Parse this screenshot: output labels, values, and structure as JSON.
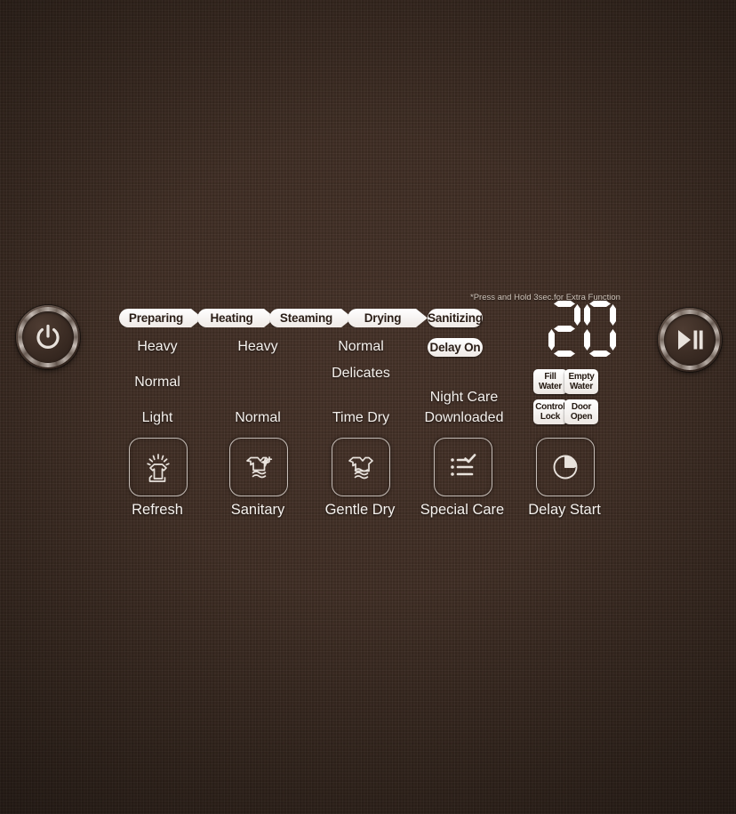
{
  "panel": {
    "background_color": "#3b2b22",
    "text_color": "#f4f0ec"
  },
  "power_button": {
    "name": "Power",
    "icon": "power-icon"
  },
  "start_button": {
    "name": "Start/Pause",
    "icon": "play-pause-icon"
  },
  "note": "*Press and Hold 3sec.for Extra Function",
  "progress_pills": [
    {
      "label": "Preparing",
      "shape": "arrow"
    },
    {
      "label": "Heating",
      "shape": "arrow"
    },
    {
      "label": "Steaming",
      "shape": "arrow"
    },
    {
      "label": "Drying",
      "shape": "arrow"
    },
    {
      "label": "Sanitizing",
      "shape": "round"
    }
  ],
  "option_labels": [
    {
      "label": "Heavy"
    },
    {
      "label": "Heavy"
    },
    {
      "label": "Normal"
    },
    {
      "label": "Delay On"
    },
    {
      "label": "Normal"
    },
    {
      "label": "Delicates"
    },
    {
      "label": "Night Care"
    },
    {
      "label": "Light"
    },
    {
      "label": "Normal"
    },
    {
      "label": "Time Dry"
    },
    {
      "label": "Downloaded"
    }
  ],
  "display": {
    "value": "20",
    "digits": [
      "2",
      "0"
    ],
    "segments": {
      "0": [
        "A",
        "B",
        "C",
        "D",
        "E",
        "F"
      ],
      "2": [
        "A",
        "B",
        "G",
        "E",
        "D"
      ]
    }
  },
  "status_chips": [
    {
      "line1": "Fill",
      "line2": "Water",
      "name": "fill-water"
    },
    {
      "line1": "Empty",
      "line2": "Water",
      "name": "empty-water"
    },
    {
      "line1": "Control",
      "line2": "Lock",
      "name": "control-lock"
    },
    {
      "line1": "Door",
      "line2": "Open",
      "name": "door-open"
    }
  ],
  "function_buttons": [
    {
      "label": "Refresh",
      "icon": "shirt-sparkle-icon"
    },
    {
      "label": "Sanitary",
      "icon": "shirt-plus-wave-icon"
    },
    {
      "label": "Gentle Dry",
      "icon": "shirt-wave-icon"
    },
    {
      "label": "Special Care",
      "icon": "checklist-icon"
    },
    {
      "label": "Delay Start",
      "icon": "clock-icon"
    }
  ]
}
